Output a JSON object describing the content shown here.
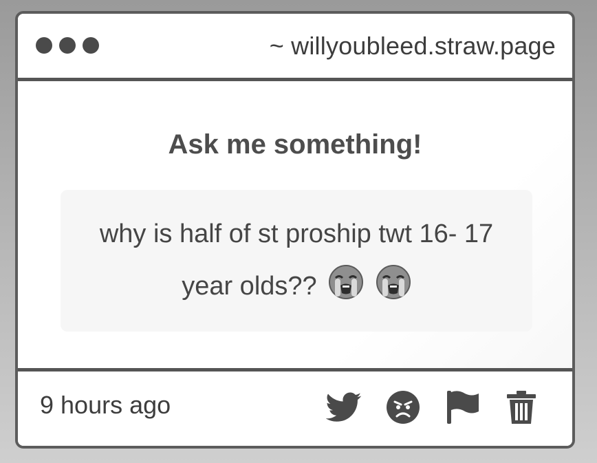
{
  "window": {
    "url": "~ willyoubleed.straw.page"
  },
  "main": {
    "heading": "Ask me something!",
    "question_text": "why is half of st proship twt 16- 17 year olds??",
    "question_emojis": [
      "loudly-crying-face-icon",
      "loudly-crying-face-icon"
    ]
  },
  "footer": {
    "timestamp": "9 hours ago",
    "actions": [
      {
        "name": "share-twitter-button",
        "icon": "twitter-bird-icon"
      },
      {
        "name": "block-button",
        "icon": "angry-face-icon"
      },
      {
        "name": "report-button",
        "icon": "flag-icon"
      },
      {
        "name": "delete-button",
        "icon": "trash-icon"
      }
    ]
  },
  "colors": {
    "frame": "#5c5c5c",
    "text": "#454545",
    "icon": "#4a4a4a",
    "question_bg": "#f6f6f6"
  }
}
